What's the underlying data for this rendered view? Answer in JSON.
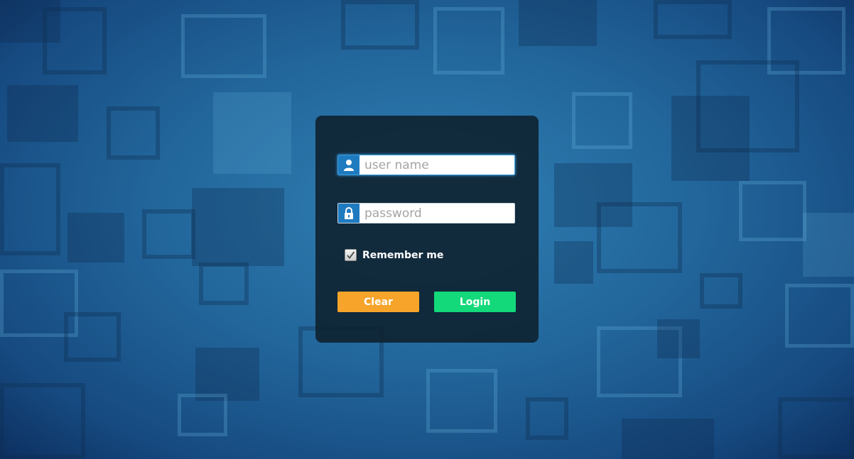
{
  "login_form": {
    "username": {
      "value": "",
      "placeholder": "user name",
      "icon": "user-icon"
    },
    "password": {
      "value": "",
      "placeholder": "password",
      "icon": "lock-icon"
    },
    "remember_me": {
      "label": "Remember me",
      "checked": true
    },
    "clear_label": "Clear",
    "login_label": "Login"
  },
  "colors": {
    "panel": "#0e202c",
    "icon_bg": "#1f7bc0",
    "clear_button": "#f6a42a",
    "login_button": "#13d97a",
    "background": "#22669b"
  }
}
